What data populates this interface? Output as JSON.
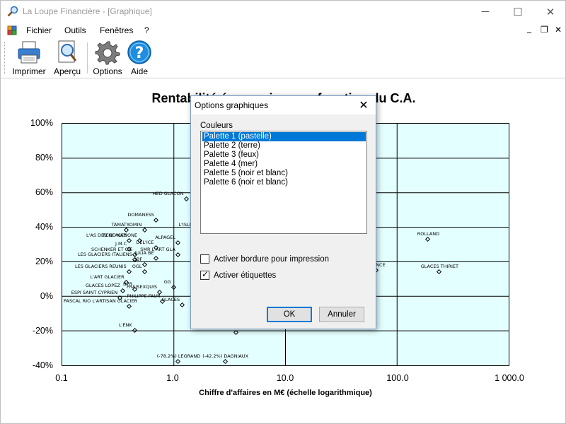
{
  "window": {
    "title": "La Loupe Financière - [Graphique]",
    "controls": {
      "minimize": "─",
      "maximize": "☐",
      "close": "✕"
    }
  },
  "menu": {
    "items": [
      "Fichier",
      "Outils",
      "Fenêtres",
      "?"
    ],
    "mdi_controls": {
      "minimize": "_",
      "restore": "❐",
      "close": "✕"
    }
  },
  "toolbar": {
    "buttons": [
      {
        "label": "Imprimer",
        "icon": "printer-icon"
      },
      {
        "label": "Aperçu",
        "icon": "print-preview-icon"
      },
      {
        "label": "Options",
        "icon": "gear-icon"
      },
      {
        "label": "Aide",
        "icon": "help-icon"
      }
    ]
  },
  "chart": {
    "title": "Rentabilité économique en fonction du C.A.",
    "xlabel": "Chiffre d'affaires en M€ (échelle logarithmique)",
    "yticks": [
      "100%",
      "80%",
      "60%",
      "40%",
      "20%",
      "0%",
      "-20%",
      "-40%"
    ],
    "xticks": [
      "0.1",
      "1.0",
      "10.0",
      "100.0",
      "1 000.0"
    ],
    "background": "#e4ffff"
  },
  "chart_data": {
    "type": "scatter",
    "title": "Rentabilité économique en fonction du C.A.",
    "xlabel": "Chiffre d'affaires en M€ (échelle logarithmique)",
    "ylabel": "",
    "x_scale": "log",
    "xlim": [
      0.1,
      1000
    ],
    "ylim": [
      -40,
      100
    ],
    "grid": true,
    "points": [
      {
        "label": "HED GLACON",
        "x": 1.3,
        "y": 56
      },
      {
        "label": "DOMANESS",
        "x": 0.7,
        "y": 44
      },
      {
        "label": "TAMA",
        "x": 0.38,
        "y": 38
      },
      {
        "label": "TXOMIN",
        "x": 0.55,
        "y": 38
      },
      {
        "label": "L'ISLE AUX D",
        "x": 1.5,
        "y": 38
      },
      {
        "label": "L'AS DES GLACES",
        "x": 0.4,
        "y": 32
      },
      {
        "label": "RENE NAPIONE",
        "x": 0.5,
        "y": 32
      },
      {
        "label": "ALPAGEL",
        "x": 1.1,
        "y": 31
      },
      {
        "label": "J.M.C",
        "x": 0.4,
        "y": 27
      },
      {
        "label": "DEL'ICE",
        "x": 0.7,
        "y": 28
      },
      {
        "label": "SCHENKER ET CIE",
        "x": 0.45,
        "y": 24
      },
      {
        "label": "SMR L'ART GLA",
        "x": 1.1,
        "y": 24
      },
      {
        "label": "JULIA BE",
        "x": 0.7,
        "y": 22
      },
      {
        "label": "LES GLACIERS ITALIENS",
        "x": 0.45,
        "y": 21
      },
      {
        "label": "SBF",
        "x": 0.55,
        "y": 18
      },
      {
        "label": "LES GLACIERS REUNIS",
        "x": 0.4,
        "y": 14
      },
      {
        "label": "OGL",
        "x": 0.55,
        "y": 14
      },
      {
        "label": "L'ART GLACIER",
        "x": 0.38,
        "y": 8
      },
      {
        "label": "B2B",
        "x": 0.45,
        "y": 4
      },
      {
        "label": "GLACES LOPEZ",
        "x": 0.35,
        "y": 3
      },
      {
        "label": "GG",
        "x": 1.0,
        "y": 5
      },
      {
        "label": "FRAISEXQUIS",
        "x": 0.75,
        "y": 2
      },
      {
        "label": "ESPI SAINT CYPRIEN",
        "x": 0.33,
        "y": -1
      },
      {
        "label": "PHILIPPE FAUR",
        "x": 0.8,
        "y": -3
      },
      {
        "label": "PASCAL RIO L'ARTISAN GLACIER",
        "x": 0.4,
        "y": -6
      },
      {
        "label": "GLACES",
        "x": 1.2,
        "y": -5
      },
      {
        "label": "L'ENK",
        "x": 0.45,
        "y": -20
      },
      {
        "label": "(-78.2%) LEGRAND",
        "x": 1.1,
        "y": -38
      },
      {
        "label": "(-42.2%) DAGNIAUX",
        "x": 2.9,
        "y": -38
      },
      {
        "label": "",
        "x": 3.6,
        "y": -21
      },
      {
        "label": "FRANCE",
        "x": 65,
        "y": 15
      },
      {
        "label": "ROLLAND",
        "x": 190,
        "y": 33
      },
      {
        "label": "GLACES THIRIET",
        "x": 240,
        "y": 14
      }
    ]
  },
  "dialog": {
    "title": "Options graphiques",
    "close": "✕",
    "colors_label": "Couleurs",
    "palettes": [
      "Palette 1 (pastelle)",
      "Palette 2 (terre)",
      "Palette 3 (feux)",
      "Palette 4 (mer)",
      "Palette 5 (noir et blanc)",
      "Palette 6 (noir et blanc)"
    ],
    "selected_index": 0,
    "border_checkbox": {
      "label": "Activer bordure pour impression",
      "checked": false
    },
    "labels_checkbox": {
      "label": "Activer étiquettes",
      "checked": true
    },
    "ok_label": "OK",
    "cancel_label": "Annuler"
  }
}
